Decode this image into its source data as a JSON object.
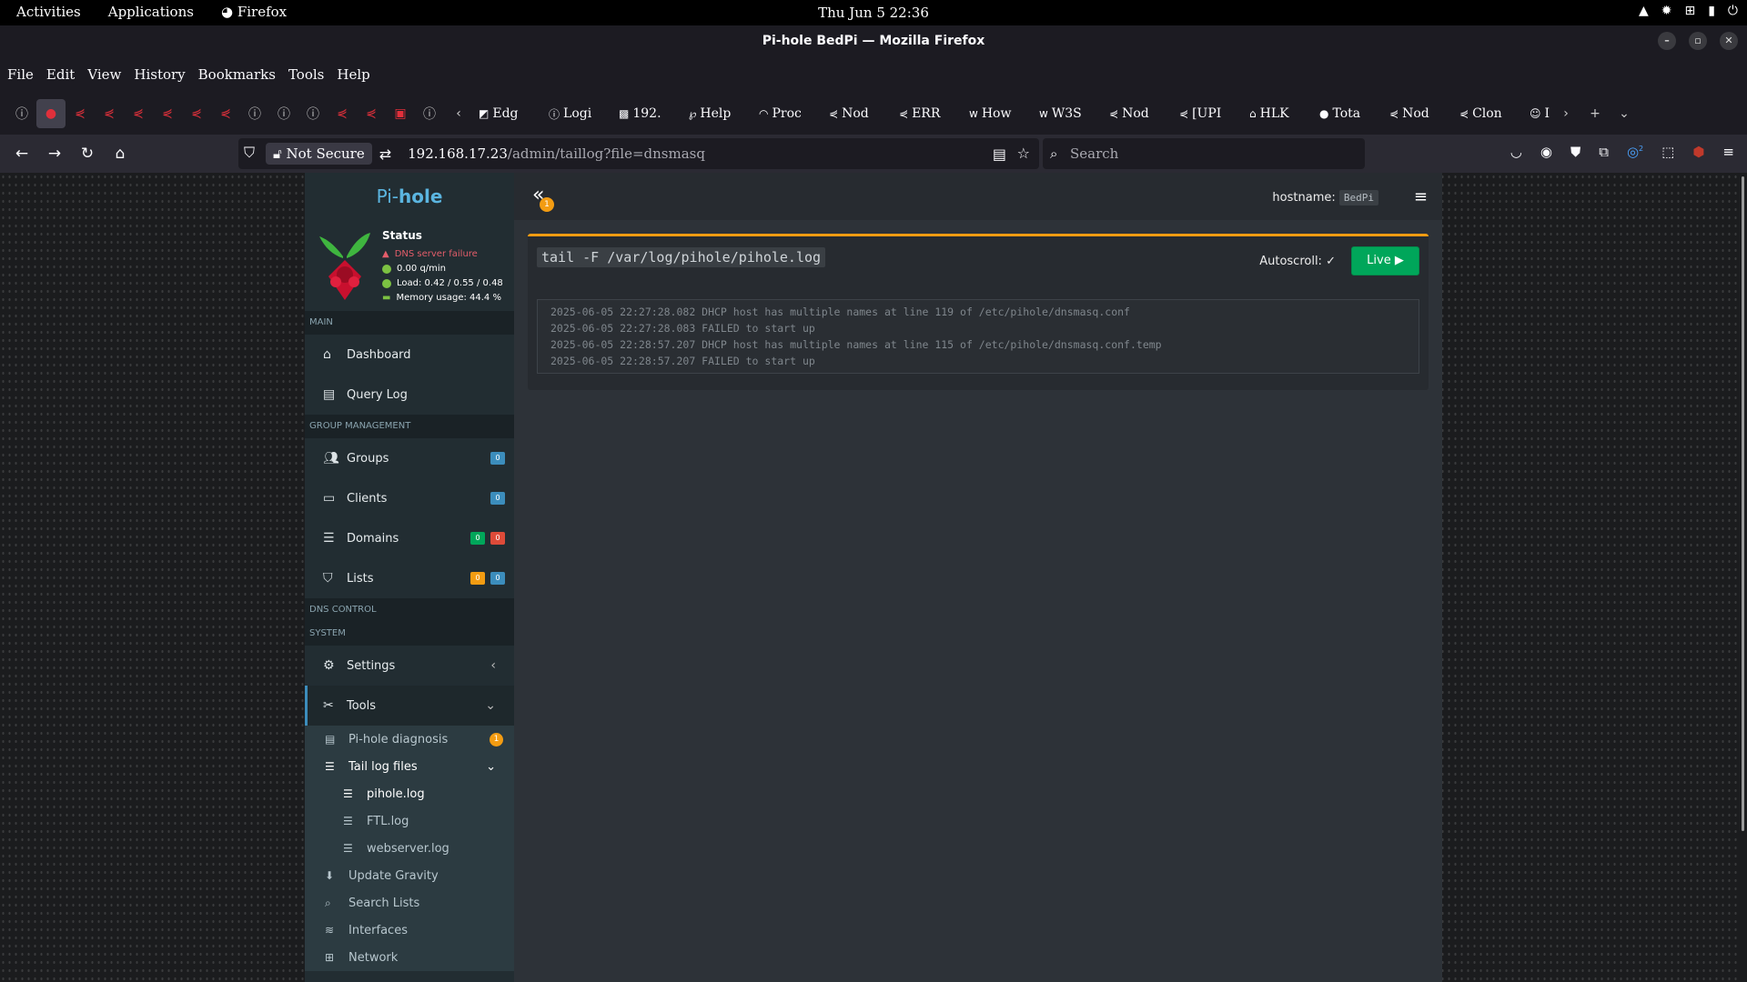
{
  "topbar": {
    "activities": "Activities",
    "applications": "Applications",
    "app": "Firefox",
    "clock": "Thu  Jun  5  22:36"
  },
  "window": {
    "title": "Pi-hole BedPi — Mozilla Firefox"
  },
  "menu": [
    "File",
    "Edit",
    "View",
    "History",
    "Bookmarks",
    "Tools",
    "Help"
  ],
  "tabs": {
    "titled": [
      "Edg",
      "Logi",
      "192.",
      "Help",
      "Proc",
      "Nod",
      "ERR",
      "How",
      "W3S",
      "Nod",
      "[UPI",
      "HLK",
      "Tota",
      "Nod",
      "Clon",
      "I"
    ]
  },
  "navbar": {
    "not_secure": "Not Secure",
    "url_host": "192.168.17.23",
    "url_path": "/admin/taillog?file=dnsmasq",
    "search_placeholder": "Search",
    "ext_badge": "2"
  },
  "sidebar": {
    "logo_pi": "Pi-",
    "logo_hole": "hole",
    "status_title": "Status",
    "status_dns": "DNS server failure",
    "status_qpm": "0.00 q/min",
    "status_load": "Load: 0.42 / 0.55 / 0.48",
    "status_mem": "Memory usage: 44.4 %",
    "sec_main": "MAIN",
    "dashboard": "Dashboard",
    "querylog": "Query Log",
    "sec_group": "GROUP MANAGEMENT",
    "groups": "Groups",
    "groups_badge": "0",
    "clients": "Clients",
    "clients_badge": "0",
    "domains": "Domains",
    "domains_badge_a": "0",
    "domains_badge_b": "0",
    "lists": "Lists",
    "lists_badge_a": "0",
    "lists_badge_b": "0",
    "sec_dns": "DNS CONTROL",
    "sec_system": "SYSTEM",
    "settings": "Settings",
    "tools": "Tools",
    "diagnosis": "Pi-hole diagnosis",
    "diagnosis_badge": "1",
    "taillog": "Tail log files",
    "pihole_log": "pihole.log",
    "ftl_log": "FTL.log",
    "webserver_log": "webserver.log",
    "gravity": "Update Gravity",
    "searchlists": "Search Lists",
    "interfaces": "Interfaces",
    "network": "Network"
  },
  "header": {
    "notif_count": "1",
    "hostname_label": "hostname:",
    "hostname_value": "BedPi"
  },
  "log": {
    "command": "tail -F /var/log/pihole/pihole.log",
    "autoscroll": "Autoscroll:",
    "live": "Live",
    "lines": [
      "2025-06-05 22:27:28.082 DHCP host has multiple names at line 119 of /etc/pihole/dnsmasq.conf",
      "2025-06-05 22:27:28.083 FAILED to start up",
      "2025-06-05 22:28:57.207 DHCP host has multiple names at line 115 of /etc/pihole/dnsmasq.conf.temp",
      "2025-06-05 22:28:57.207 FAILED to start up"
    ]
  }
}
